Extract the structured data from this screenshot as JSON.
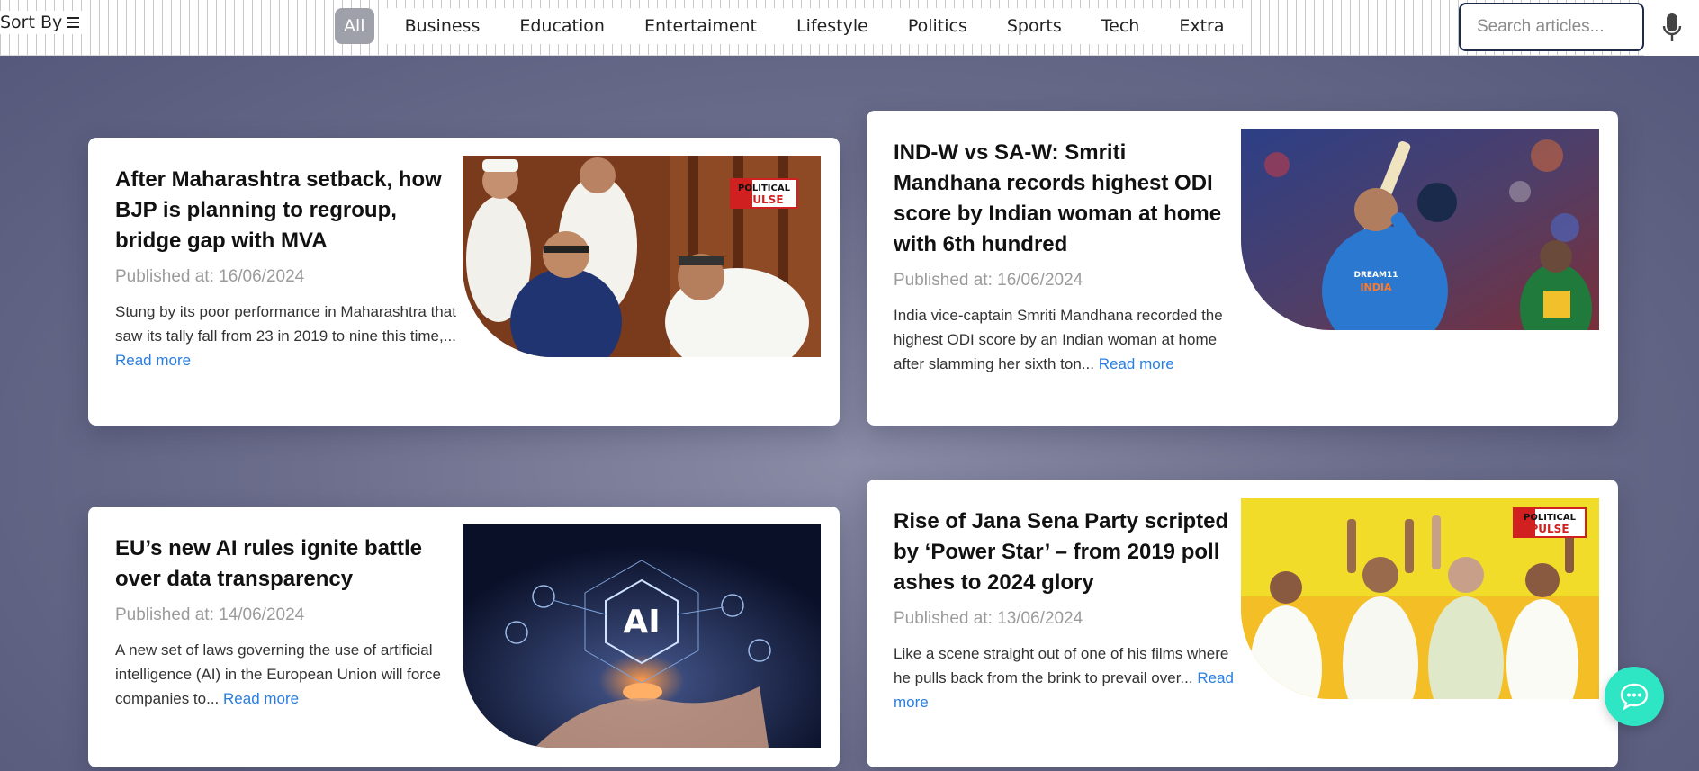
{
  "header": {
    "sort_label": "Sort By",
    "categories": [
      {
        "label": "All",
        "active": true
      },
      {
        "label": "Business"
      },
      {
        "label": "Education"
      },
      {
        "label": "Entertaiment"
      },
      {
        "label": "Lifestyle"
      },
      {
        "label": "Politics"
      },
      {
        "label": "Sports"
      },
      {
        "label": "Tech"
      },
      {
        "label": "Extra"
      }
    ],
    "search_placeholder": "Search articles...",
    "mic_icon": "microphone-icon"
  },
  "articles": [
    {
      "title": "After Maharashtra setback, how BJP is planning to regroup, bridge gap with MVA",
      "published": "Published at: 16/06/2024",
      "excerpt": "Stung by its poor performance in Maharashtra that saw its tally fall from 23 in 2019 to nine this time,...",
      "read_more": "Read more",
      "badge": [
        "POLITICAL",
        "PULSE"
      ]
    },
    {
      "title": "IND-W vs SA-W: Smriti Mandhana records highest ODI score by Indian woman at home with 6th hundred",
      "published": "Published at: 16/06/2024",
      "excerpt": "India vice-captain Smriti Mandhana recorded the highest ODI score by an Indian woman at home after slamming her sixth ton...",
      "read_more": "Read more",
      "jersey": [
        "DREAM11",
        "INDIA"
      ]
    },
    {
      "title": "EU’s new AI rules ignite battle over data transparency",
      "published": "Published at: 14/06/2024",
      "excerpt": "A new set of laws governing the use of artificial intelligence (AI) in the European Union will force companies to...",
      "read_more": "Read more",
      "image_label": "AI"
    },
    {
      "title": "Rise of Jana Sena Party scripted by ‘Power Star’ – from 2019 poll ashes to 2024 glory",
      "published": "Published at: 13/06/2024",
      "excerpt": "Like a scene straight out of one of his films where he pulls back from the brink to prevail over...",
      "read_more": "Read more",
      "badge": [
        "POLITICAL",
        "PULSE"
      ]
    }
  ],
  "chat_icon": "chat-bubble-icon",
  "colors": {
    "accent": "#2a7de1",
    "chat": "#2ee6c4",
    "active_tab": "#9fa1aa"
  }
}
